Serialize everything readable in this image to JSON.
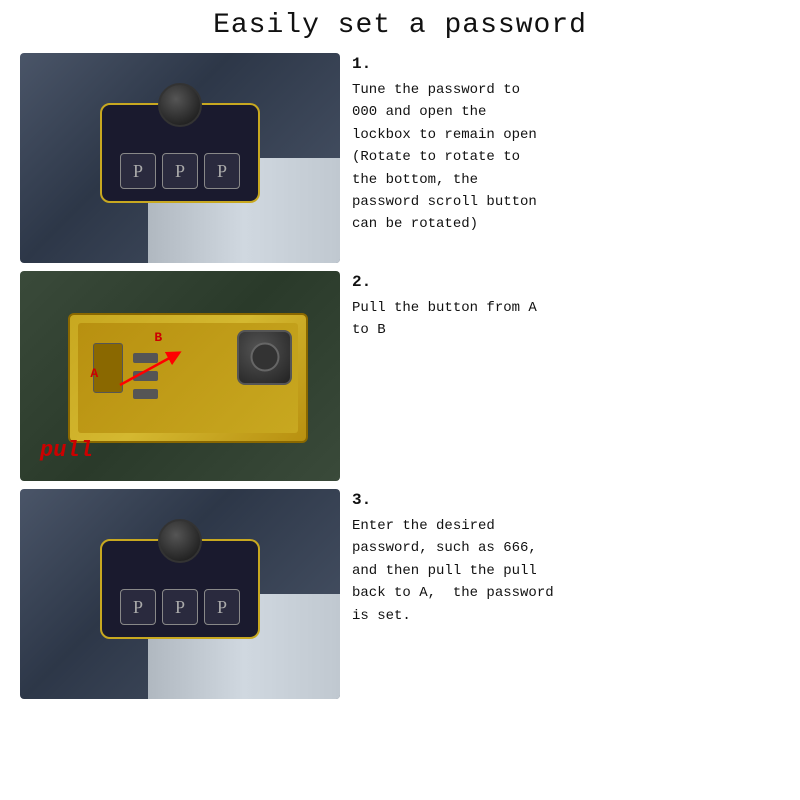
{
  "title": "Easily set a password",
  "steps": [
    {
      "number": "1.",
      "description": "Tune the password to\n000 and open the\nlockbox to remain open\n(Rotate to rotate to\nthe bottom, the\npassword scroll button\ncan be rotated)"
    },
    {
      "number": "2.",
      "description": "Pull the button from A\nto B"
    },
    {
      "number": "3.",
      "description": "Enter the desired\npassword, such as 666,\nand then pull the pull\nback to A,  the password\nis set."
    }
  ],
  "combo_digits": [
    "P",
    "P",
    "P"
  ],
  "pull_label": "pull"
}
